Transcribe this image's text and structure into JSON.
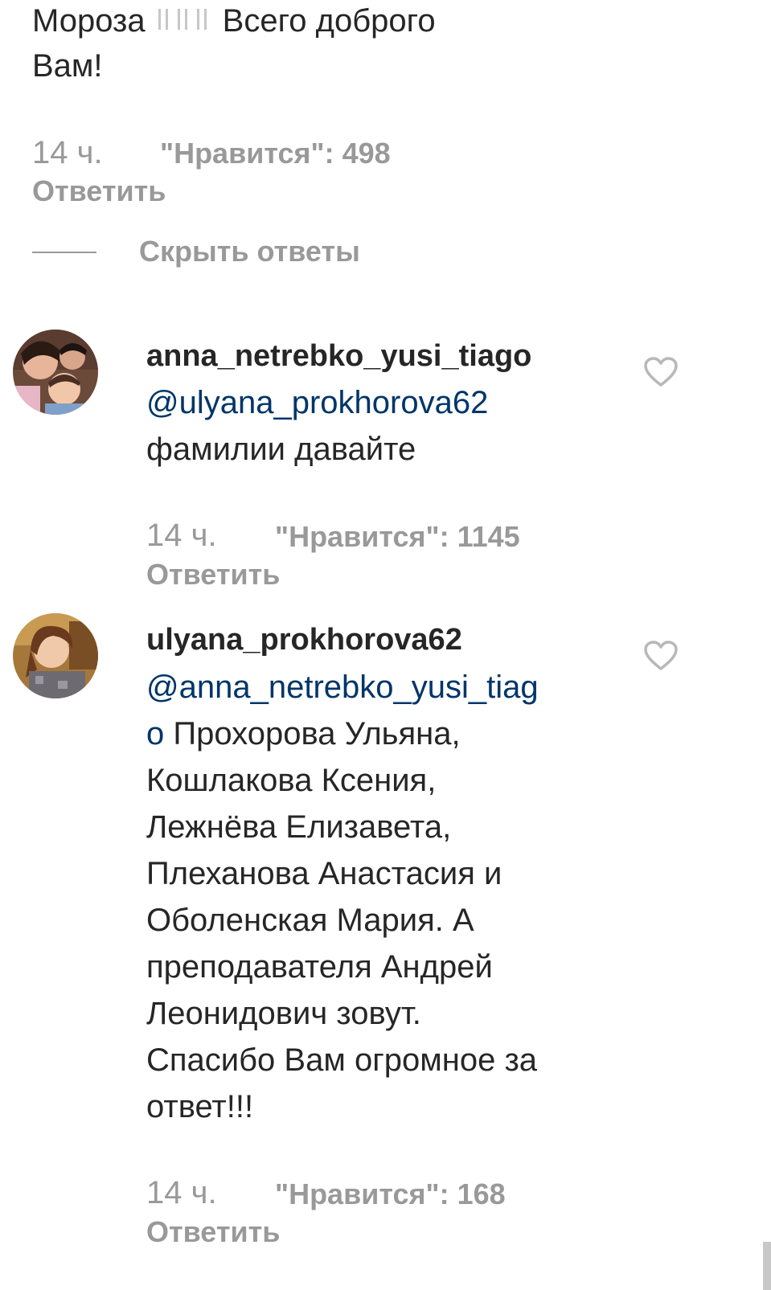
{
  "parent_comment": {
    "text_part1": "Мороза",
    "text_part2": "Всего доброго",
    "text_line2": "Вам!",
    "time": "14 ч.",
    "likes": "\"Нравится\": 498",
    "reply": "Ответить"
  },
  "hide_replies": "Скрыть ответы",
  "replies": [
    {
      "username": "anna_netrebko_yusi_tiago",
      "mention": "@ulyana_prokhorova62",
      "text": "фамилии давайте",
      "time": "14 ч.",
      "likes": "\"Нравится\": 1145",
      "reply": "Ответить",
      "avatar_icon": "avatar-photo"
    },
    {
      "username": "ulyana_prokhorova62",
      "mention_line1": "@anna_netrebko_yusi_tiag",
      "mention_line2": "o",
      "text_lines": [
        " Прохорова Ульяна,",
        "Кошлакова Ксения,",
        "Лежнёва Елизавета,",
        "Плеханова Анастасия и",
        "Оболенская Мария. А",
        "преподавателя Андрей",
        "Леонидович зовут.",
        "Спасибо Вам огромное за",
        "ответ!!!"
      ],
      "time": "14 ч.",
      "likes": "\"Нравится\": 168",
      "reply": "Ответить",
      "avatar_icon": "avatar-photo"
    }
  ],
  "icons": {
    "like": "heart-outline-icon"
  },
  "colors": {
    "text": "#262626",
    "muted": "#999999",
    "mention": "#003569"
  }
}
